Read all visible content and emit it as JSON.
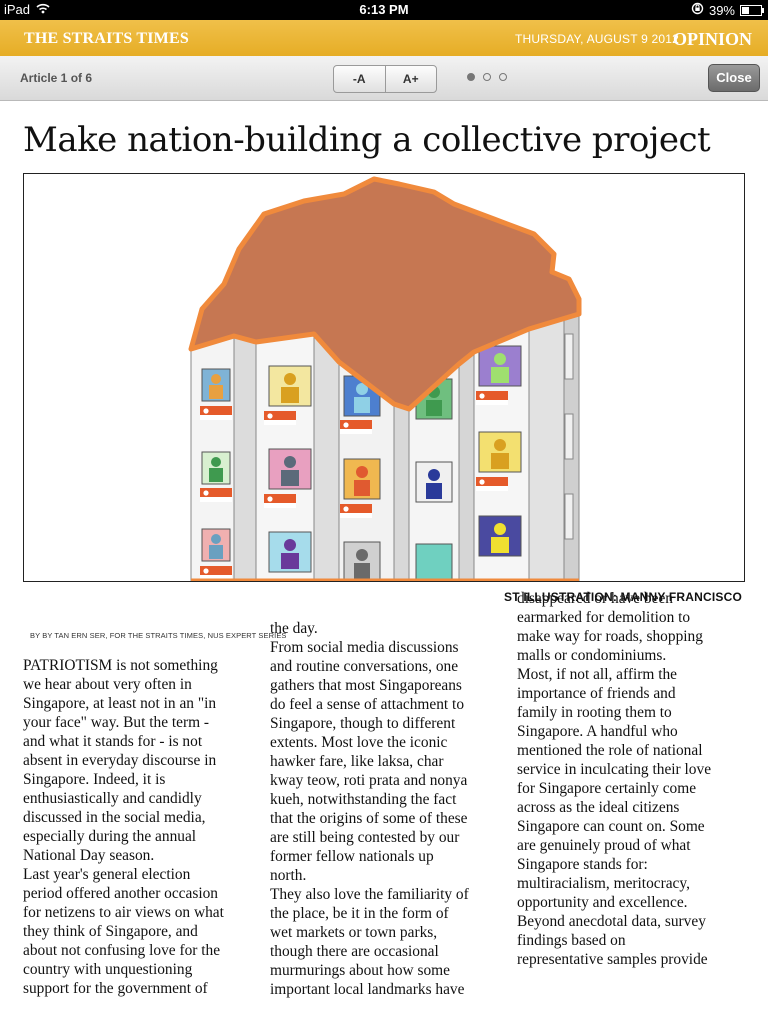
{
  "status_bar": {
    "device": "iPad",
    "time": "6:13 PM",
    "battery": "39%"
  },
  "masthead": {
    "title": "THE STRAITS TIMES",
    "date": "THURSDAY, AUGUST 9 2012",
    "section": "OPINION"
  },
  "toolbar": {
    "article_counter": "Article 1 of 6",
    "font_decrease": "-A",
    "font_increase": "A+",
    "page_dots": 3,
    "current_page_dot": 1,
    "close_label": "Close"
  },
  "article": {
    "headline": "Make nation-building a collective project",
    "illustration_credit": "ST ILLUSTRATION: MANNY FRANCISCO",
    "byline": "BY BY TAN ERN SER, FOR THE STRAITS TIMES, NUS EXPERT SERIES",
    "col1": "PATRIOTISM is not something\nwe hear about very often in\nSingapore, at least not in an \"in\nyour face\" way. But the term -\nand what it stands for - is not\nabsent in everyday discourse in\nSingapore. Indeed, it is\nenthusiastically and candidly\ndiscussed in the social media,\nespecially during the annual\nNational Day season.\n Last year's general election\nperiod offered another occasion\nfor netizens to air views on what\nthey think of Singapore, and\nabout not confusing love for the\ncountry with unquestioning\nsupport for the government of",
    "col2": "the day.\n From social media discussions\nand routine conversations, one\ngathers that most Singaporeans\ndo feel a sense of attachment to\nSingapore, though to different\nextents. Most love the iconic\nhawker fare, like laksa, char\nkway teow, roti prata and nonya\nkueh, notwithstanding the fact\nthat the origins of some of these\nare still being contested by our\nformer fellow nationals up\nnorth.\n They also love the familiarity of\nthe place, be it in the form of\nwet markets or town parks,\nthough there are occasional\nmurmurings about how some\nimportant local landmarks have",
    "col3": "disappeared or have been\nearmarked for demolition to\nmake way for roads, shopping\nmalls or condominiums.\n Most, if not all, affirm the\nimportance of friends and\nfamily in rooting them to\nSingapore. A handful who\nmentioned the role of national\nservice in inculcating their love\nfor Singapore certainly come\nacross as the ideal citizens\nSingapore can count on. Some\nare genuinely proud of what\nSingapore stands for:\nmultiracialism, meritocracy,\nopportunity and excellence.\n Beyond anecdotal data, survey\nfindings based on\nrepresentative samples provide"
  },
  "colors": {
    "masthead": "#e8b030",
    "accent": "#e25a20",
    "roof": "#c87a55",
    "roof_outline": "#f08a3c"
  }
}
